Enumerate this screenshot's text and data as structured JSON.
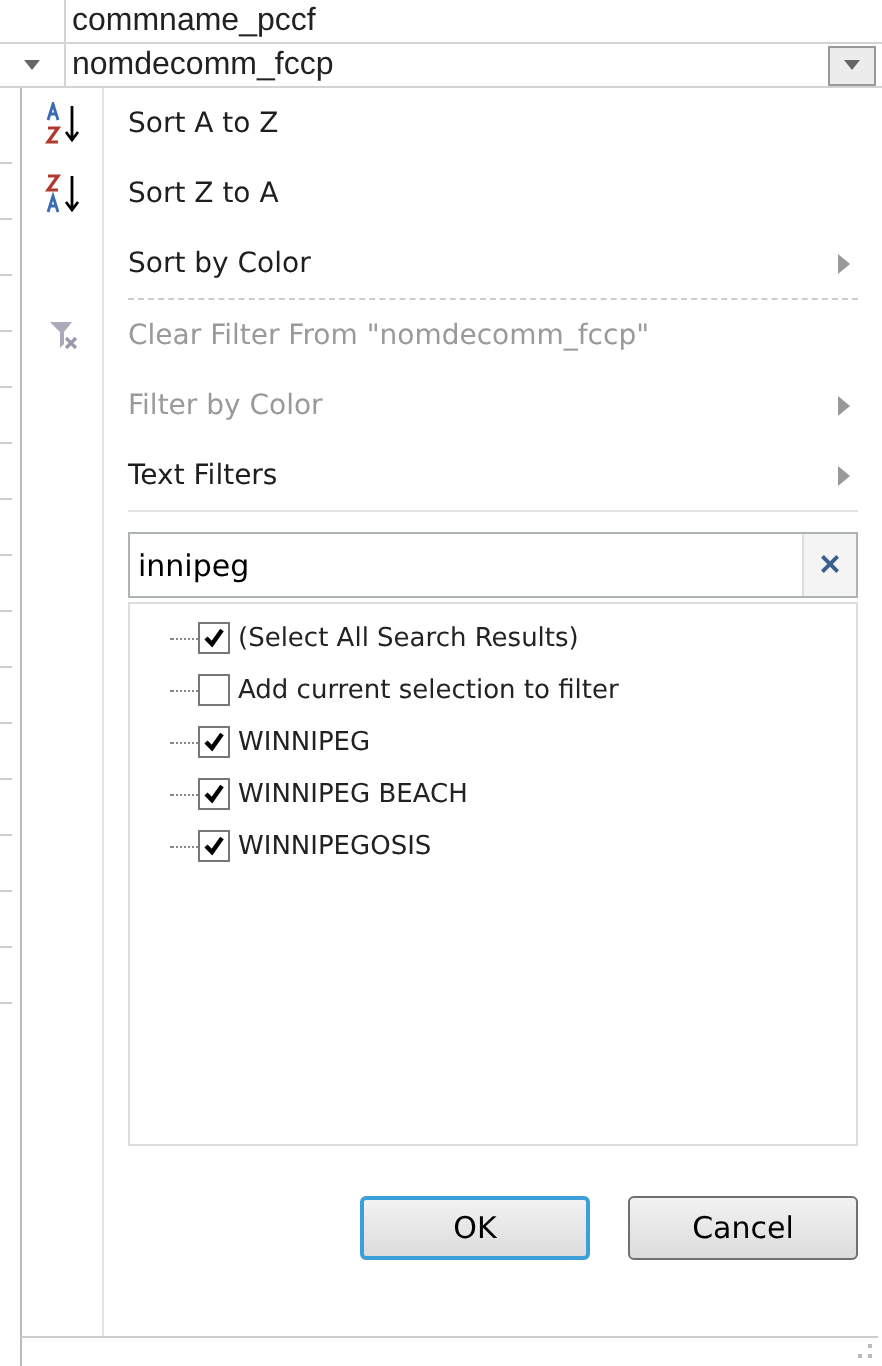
{
  "header_cells": [
    {
      "text": "commname_pccf",
      "has_dropdown": false
    },
    {
      "text": "nomdecomm_fccp",
      "has_dropdown": true
    }
  ],
  "menu_items": [
    {
      "kind": "sort_ascending",
      "label": "Sort A to Z",
      "disabled": false,
      "submenu": false
    },
    {
      "kind": "sort_descending",
      "label": "Sort Z to A",
      "disabled": false,
      "submenu": false
    },
    {
      "kind": "item",
      "label": "Sort by Color",
      "disabled": false,
      "submenu": true
    },
    {
      "kind": "separator"
    },
    {
      "kind": "clear_filter",
      "label": "Clear Filter From \"nomdecomm_fccp\"",
      "disabled": true,
      "submenu": false
    },
    {
      "kind": "item",
      "label": "Filter by Color",
      "disabled": true,
      "submenu": true
    },
    {
      "kind": "item",
      "label": "Text Filters",
      "disabled": false,
      "submenu": true
    }
  ],
  "search": {
    "value": "innipeg",
    "clear": "×"
  },
  "list": [
    {
      "label": "(Select All Search Results)",
      "checked": true
    },
    {
      "label": "Add current selection to filter",
      "checked": false
    },
    {
      "label": "WINNIPEG",
      "checked": true
    },
    {
      "label": "WINNIPEG BEACH",
      "checked": true
    },
    {
      "label": "WINNIPEGOSIS",
      "checked": true
    }
  ],
  "buttons": [
    {
      "label": "OK",
      "default": true
    },
    {
      "label": "Cancel",
      "default": false
    }
  ]
}
